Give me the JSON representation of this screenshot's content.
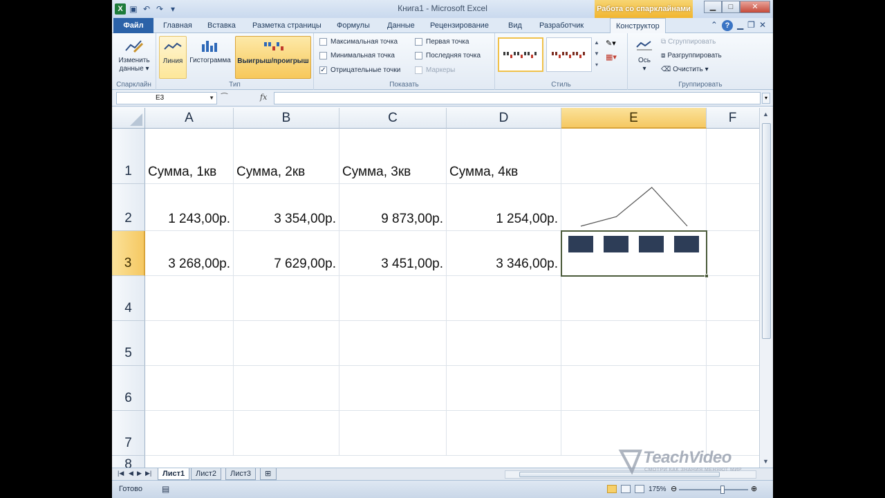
{
  "window": {
    "title": "Книга1  -  Microsoft Excel",
    "context_tab": "Работа со спарклайнами"
  },
  "tabs": [
    {
      "label": "Файл"
    },
    {
      "label": "Главная"
    },
    {
      "label": "Вставка"
    },
    {
      "label": "Разметка страницы"
    },
    {
      "label": "Формулы"
    },
    {
      "label": "Данные"
    },
    {
      "label": "Рецензирование"
    },
    {
      "label": "Вид"
    },
    {
      "label": "Разработчик"
    },
    {
      "label": "Конструктор"
    }
  ],
  "ribbon": {
    "sparkline_group": {
      "label": "Спарклайн",
      "edit_data_line1": "Изменить",
      "edit_data_line2": "данные"
    },
    "type_group": {
      "label": "Тип",
      "line": "Линия",
      "column": "Гистограмма",
      "winloss": "Выигрыш/проигрыш"
    },
    "show_group": {
      "label": "Показать",
      "high_point": "Максимальная точка",
      "low_point": "Минимальная точка",
      "negative_points": "Отрицательные точки",
      "first_point": "Первая точка",
      "last_point": "Последняя точка",
      "markers": "Маркеры",
      "negative_checked": true
    },
    "style_group": {
      "label": "Стиль"
    },
    "group_group": {
      "label": "Группировать",
      "axis": "Ось",
      "group": "Сгруппировать",
      "ungroup": "Разгруппировать",
      "clear": "Очистить"
    }
  },
  "formula_bar": {
    "name_box": "E3",
    "fx": "fx",
    "formula": ""
  },
  "columns": [
    "A",
    "B",
    "C",
    "D",
    "E",
    "F"
  ],
  "rows": [
    "1",
    "2",
    "3",
    "4",
    "5",
    "6",
    "7",
    "8"
  ],
  "cells": {
    "A1": "Сумма, 1кв",
    "B1": "Сумма, 2кв",
    "C1": "Сумма, 3кв",
    "D1": "Сумма, 4кв",
    "A2": "1 243,00р.",
    "B2": "3 354,00р.",
    "C2": "9 873,00р.",
    "D2": "1 254,00р.",
    "A3": "3 268,00р.",
    "B3": "7 629,00р.",
    "C3": "3 451,00р.",
    "D3": "3 346,00р."
  },
  "sparklines": {
    "line_values": [
      1243,
      3354,
      9873,
      1254
    ],
    "winloss_values": [
      3268,
      7629,
      3451,
      3346
    ],
    "color": "#2d3d57"
  },
  "sheets": [
    {
      "label": "Лист1",
      "active": true
    },
    {
      "label": "Лист2",
      "active": false
    },
    {
      "label": "Лист3",
      "active": false
    }
  ],
  "status": {
    "ready": "Готово",
    "zoom": "175%"
  },
  "watermark": {
    "brand": "TeachVideo",
    "tagline": "СМОТРИ КАК ЗНАНИЯ МЕНЯЮТ МИР"
  }
}
